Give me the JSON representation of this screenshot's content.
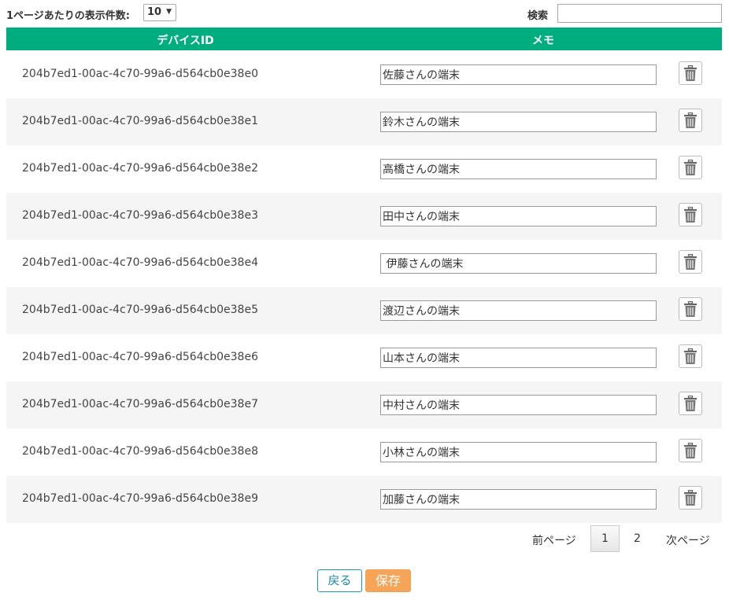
{
  "toolbar": {
    "length_label": "1ページあたりの表示件数:",
    "length_value": "10",
    "search_label": "検索",
    "search_value": ""
  },
  "table": {
    "header_color": "#00ad7f",
    "columns": [
      "デバイスID",
      "メモ"
    ],
    "rows": [
      {
        "device_id": "204b7ed1-00ac-4c70-99a6-d564cb0e38e0",
        "memo": "佐藤さんの端末"
      },
      {
        "device_id": "204b7ed1-00ac-4c70-99a6-d564cb0e38e1",
        "memo": "鈴木さんの端末"
      },
      {
        "device_id": "204b7ed1-00ac-4c70-99a6-d564cb0e38e2",
        "memo": "高橋さんの端末"
      },
      {
        "device_id": "204b7ed1-00ac-4c70-99a6-d564cb0e38e3",
        "memo": "田中さんの端末"
      },
      {
        "device_id": "204b7ed1-00ac-4c70-99a6-d564cb0e38e4",
        "memo": " 伊藤さんの端末"
      },
      {
        "device_id": "204b7ed1-00ac-4c70-99a6-d564cb0e38e5",
        "memo": "渡辺さんの端末"
      },
      {
        "device_id": "204b7ed1-00ac-4c70-99a6-d564cb0e38e6",
        "memo": "山本さんの端末"
      },
      {
        "device_id": "204b7ed1-00ac-4c70-99a6-d564cb0e38e7",
        "memo": "中村さんの端末"
      },
      {
        "device_id": "204b7ed1-00ac-4c70-99a6-d564cb0e38e8",
        "memo": "小林さんの端末"
      },
      {
        "device_id": "204b7ed1-00ac-4c70-99a6-d564cb0e38e9",
        "memo": "加藤さんの端末"
      }
    ],
    "delete_icon": "trash-icon"
  },
  "pagination": {
    "prev": "前ページ",
    "pages": [
      "1",
      "2"
    ],
    "current": "1",
    "next": "次ページ"
  },
  "actions": {
    "back": "戻る",
    "save": "保存",
    "back_color": "#1a9bb5",
    "save_color": "#f6a558"
  }
}
